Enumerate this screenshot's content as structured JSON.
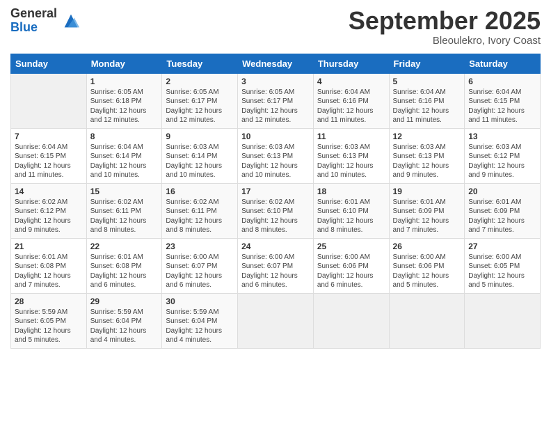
{
  "header": {
    "logo_general": "General",
    "logo_blue": "Blue",
    "month": "September 2025",
    "location": "Bleoulekro, Ivory Coast"
  },
  "weekdays": [
    "Sunday",
    "Monday",
    "Tuesday",
    "Wednesday",
    "Thursday",
    "Friday",
    "Saturday"
  ],
  "weeks": [
    [
      {
        "day": "",
        "info": ""
      },
      {
        "day": "1",
        "info": "Sunrise: 6:05 AM\nSunset: 6:18 PM\nDaylight: 12 hours\nand 12 minutes."
      },
      {
        "day": "2",
        "info": "Sunrise: 6:05 AM\nSunset: 6:17 PM\nDaylight: 12 hours\nand 12 minutes."
      },
      {
        "day": "3",
        "info": "Sunrise: 6:05 AM\nSunset: 6:17 PM\nDaylight: 12 hours\nand 12 minutes."
      },
      {
        "day": "4",
        "info": "Sunrise: 6:04 AM\nSunset: 6:16 PM\nDaylight: 12 hours\nand 11 minutes."
      },
      {
        "day": "5",
        "info": "Sunrise: 6:04 AM\nSunset: 6:16 PM\nDaylight: 12 hours\nand 11 minutes."
      },
      {
        "day": "6",
        "info": "Sunrise: 6:04 AM\nSunset: 6:15 PM\nDaylight: 12 hours\nand 11 minutes."
      }
    ],
    [
      {
        "day": "7",
        "info": "Sunrise: 6:04 AM\nSunset: 6:15 PM\nDaylight: 12 hours\nand 11 minutes."
      },
      {
        "day": "8",
        "info": "Sunrise: 6:04 AM\nSunset: 6:14 PM\nDaylight: 12 hours\nand 10 minutes."
      },
      {
        "day": "9",
        "info": "Sunrise: 6:03 AM\nSunset: 6:14 PM\nDaylight: 12 hours\nand 10 minutes."
      },
      {
        "day": "10",
        "info": "Sunrise: 6:03 AM\nSunset: 6:13 PM\nDaylight: 12 hours\nand 10 minutes."
      },
      {
        "day": "11",
        "info": "Sunrise: 6:03 AM\nSunset: 6:13 PM\nDaylight: 12 hours\nand 10 minutes."
      },
      {
        "day": "12",
        "info": "Sunrise: 6:03 AM\nSunset: 6:13 PM\nDaylight: 12 hours\nand 9 minutes."
      },
      {
        "day": "13",
        "info": "Sunrise: 6:03 AM\nSunset: 6:12 PM\nDaylight: 12 hours\nand 9 minutes."
      }
    ],
    [
      {
        "day": "14",
        "info": "Sunrise: 6:02 AM\nSunset: 6:12 PM\nDaylight: 12 hours\nand 9 minutes."
      },
      {
        "day": "15",
        "info": "Sunrise: 6:02 AM\nSunset: 6:11 PM\nDaylight: 12 hours\nand 8 minutes."
      },
      {
        "day": "16",
        "info": "Sunrise: 6:02 AM\nSunset: 6:11 PM\nDaylight: 12 hours\nand 8 minutes."
      },
      {
        "day": "17",
        "info": "Sunrise: 6:02 AM\nSunset: 6:10 PM\nDaylight: 12 hours\nand 8 minutes."
      },
      {
        "day": "18",
        "info": "Sunrise: 6:01 AM\nSunset: 6:10 PM\nDaylight: 12 hours\nand 8 minutes."
      },
      {
        "day": "19",
        "info": "Sunrise: 6:01 AM\nSunset: 6:09 PM\nDaylight: 12 hours\nand 7 minutes."
      },
      {
        "day": "20",
        "info": "Sunrise: 6:01 AM\nSunset: 6:09 PM\nDaylight: 12 hours\nand 7 minutes."
      }
    ],
    [
      {
        "day": "21",
        "info": "Sunrise: 6:01 AM\nSunset: 6:08 PM\nDaylight: 12 hours\nand 7 minutes."
      },
      {
        "day": "22",
        "info": "Sunrise: 6:01 AM\nSunset: 6:08 PM\nDaylight: 12 hours\nand 6 minutes."
      },
      {
        "day": "23",
        "info": "Sunrise: 6:00 AM\nSunset: 6:07 PM\nDaylight: 12 hours\nand 6 minutes."
      },
      {
        "day": "24",
        "info": "Sunrise: 6:00 AM\nSunset: 6:07 PM\nDaylight: 12 hours\nand 6 minutes."
      },
      {
        "day": "25",
        "info": "Sunrise: 6:00 AM\nSunset: 6:06 PM\nDaylight: 12 hours\nand 6 minutes."
      },
      {
        "day": "26",
        "info": "Sunrise: 6:00 AM\nSunset: 6:06 PM\nDaylight: 12 hours\nand 5 minutes."
      },
      {
        "day": "27",
        "info": "Sunrise: 6:00 AM\nSunset: 6:05 PM\nDaylight: 12 hours\nand 5 minutes."
      }
    ],
    [
      {
        "day": "28",
        "info": "Sunrise: 5:59 AM\nSunset: 6:05 PM\nDaylight: 12 hours\nand 5 minutes."
      },
      {
        "day": "29",
        "info": "Sunrise: 5:59 AM\nSunset: 6:04 PM\nDaylight: 12 hours\nand 4 minutes."
      },
      {
        "day": "30",
        "info": "Sunrise: 5:59 AM\nSunset: 6:04 PM\nDaylight: 12 hours\nand 4 minutes."
      },
      {
        "day": "",
        "info": ""
      },
      {
        "day": "",
        "info": ""
      },
      {
        "day": "",
        "info": ""
      },
      {
        "day": "",
        "info": ""
      }
    ]
  ]
}
